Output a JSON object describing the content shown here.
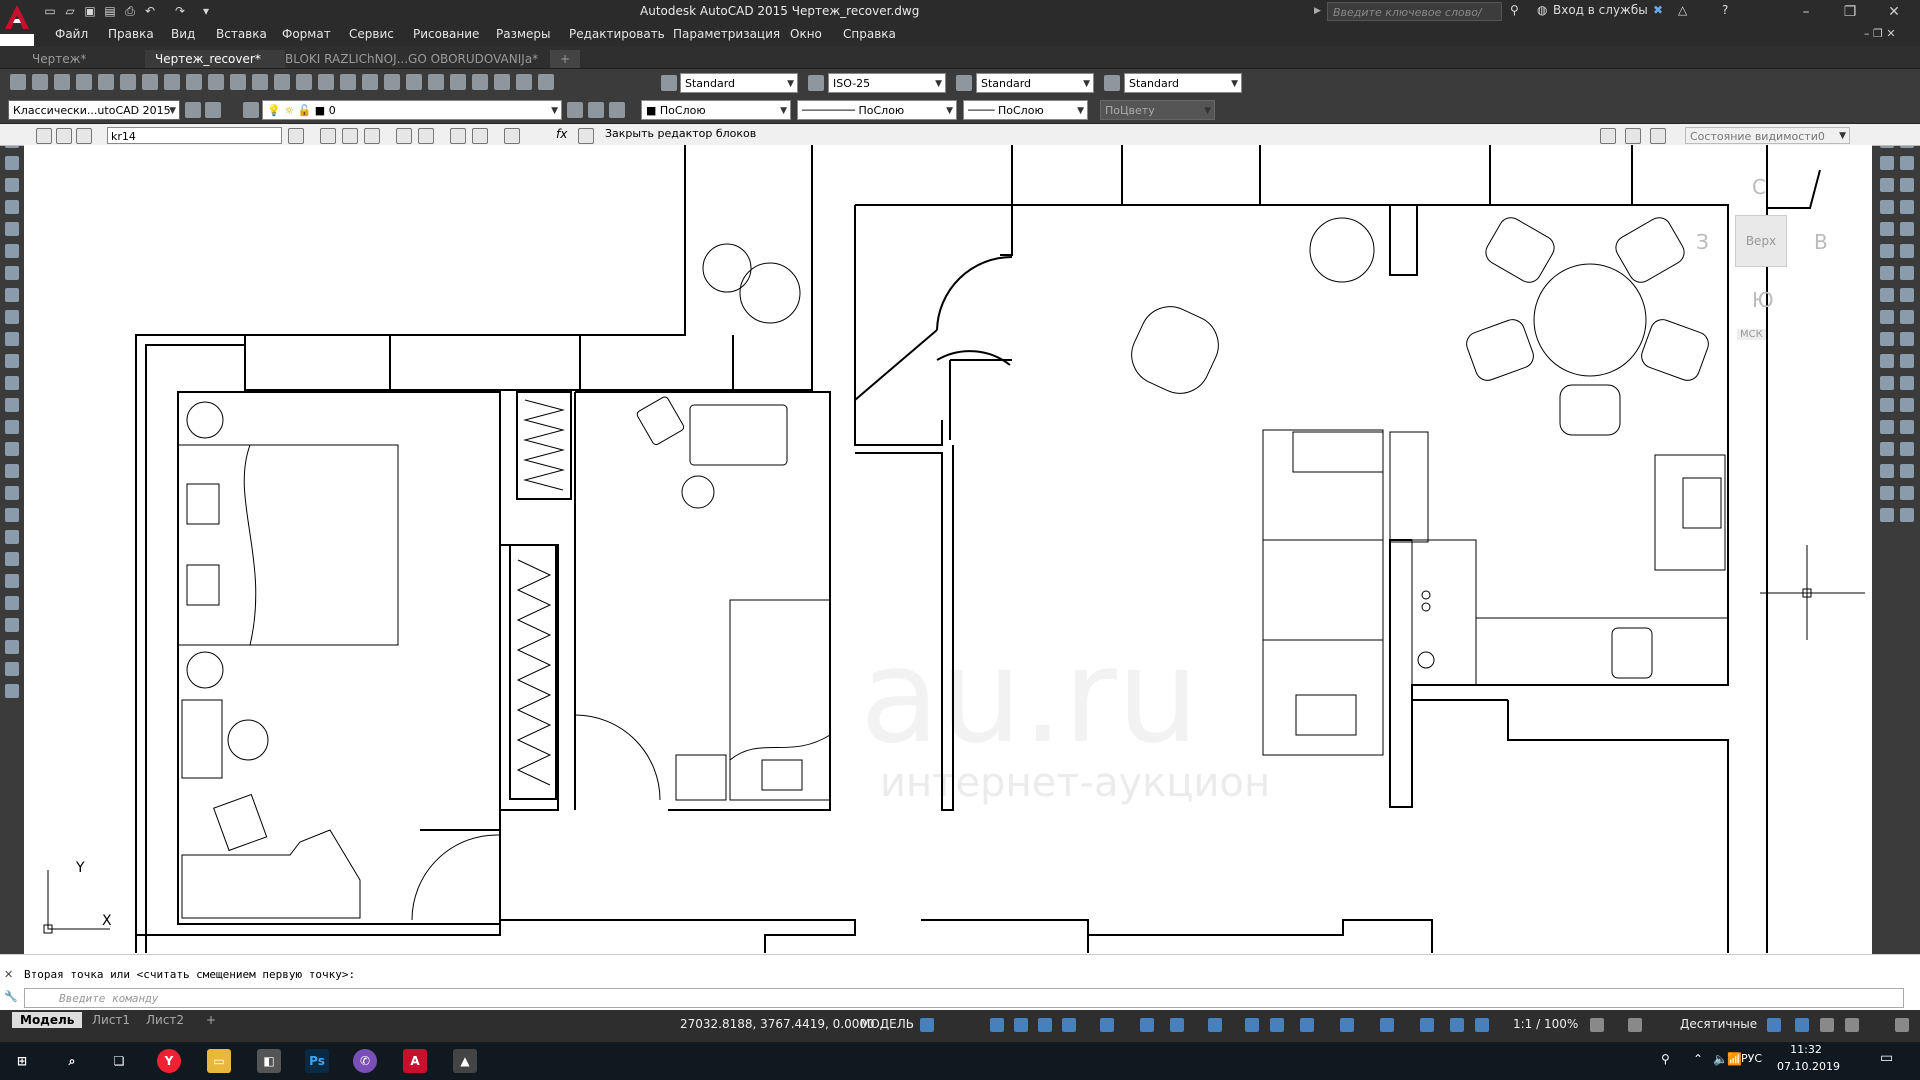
{
  "app": {
    "title": "Autodesk AutoCAD 2015   Чертеж_recover.dwg",
    "search_placeholder": "Введите ключевое слово/фразу",
    "signin_label": "Вход в службы"
  },
  "menu": [
    "Файл",
    "Правка",
    "Вид",
    "Вставка",
    "Формат",
    "Сервис",
    "Рисование",
    "Размеры",
    "Редактировать",
    "Параметризация",
    "Окно",
    "Справка"
  ],
  "tabs": [
    {
      "label": "Чертеж*",
      "active": false
    },
    {
      "label": "Чертеж_recover*",
      "active": true
    },
    {
      "label": "BLOKI RAZLIChNOJ...GO OBORUDOVANIJa*",
      "active": false
    }
  ],
  "toolbar1": {
    "text_style": "Standard",
    "dim_style": "ISO-25",
    "table_style": "Standard",
    "mleader_style": "Standard"
  },
  "toolbar2": {
    "workspace": "Классически...utoCAD 2015",
    "layer": "0",
    "color": "ПоСлою",
    "linetype": "ПоСлою",
    "lineweight": "ПоСлою",
    "plotstyle": "ПоЦвету"
  },
  "block_editor": {
    "block_name": "kr14",
    "close_label": "Закрыть редактор блоков",
    "visibility_state": "Состояние видимости0"
  },
  "viewcube": {
    "face": "Верх",
    "north": "С",
    "south": "Ю",
    "east": "В",
    "west": "З",
    "wcs": "МСК"
  },
  "ucs": {
    "x": "X",
    "y": "Y"
  },
  "watermark": {
    "main": "au.ru",
    "sub": "интернет-аукцион"
  },
  "command": {
    "history": "Вторая точка или <считать смещением первую точку>:",
    "placeholder": "Введите команду"
  },
  "layout_tabs": [
    {
      "label": "Модель",
      "active": true
    },
    {
      "label": "Лист1",
      "active": false
    },
    {
      "label": "Лист2",
      "active": false
    }
  ],
  "status": {
    "coords": "27032.8188, 3767.4419, 0.0000",
    "mode": "МОДЕЛЬ",
    "scale": "1:1 / 100%",
    "units": "Десятичные"
  },
  "taskbar": {
    "lang": "РУС",
    "time": "11:32",
    "date": "07.10.2019"
  },
  "colors": {
    "dark_chrome": "#2b2b2b",
    "toolbar": "#3b3b3b",
    "accent_red": "#c8102e",
    "taskbar": "#101820"
  }
}
